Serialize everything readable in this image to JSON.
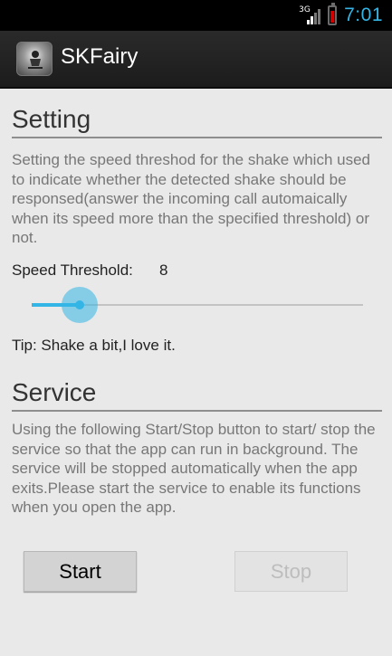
{
  "status_bar": {
    "network": "3G",
    "time": "7:01"
  },
  "app": {
    "title": "SKFairy"
  },
  "setting": {
    "heading": "Setting",
    "description": "Setting the speed threshod for the shake which used to indicate whether the detected shake should be responsed(answer the incoming call automaically when its speed more than the specified threshold) or not.",
    "threshold_label": "Speed Threshold:",
    "threshold_value": "8",
    "slider_fraction": 0.05,
    "tip": "Tip: Shake a bit,I love it."
  },
  "service": {
    "heading": "Service",
    "description": "Using the following Start/Stop button to start/ stop the service so that the app can run in background. The service will be stopped automatically when the app exits.Please start the service to enable its functions when you open the app.",
    "start_label": "Start",
    "stop_label": "Stop",
    "stop_enabled": false
  },
  "colors": {
    "accent": "#33b5e5",
    "battery_low": "#d40000"
  }
}
